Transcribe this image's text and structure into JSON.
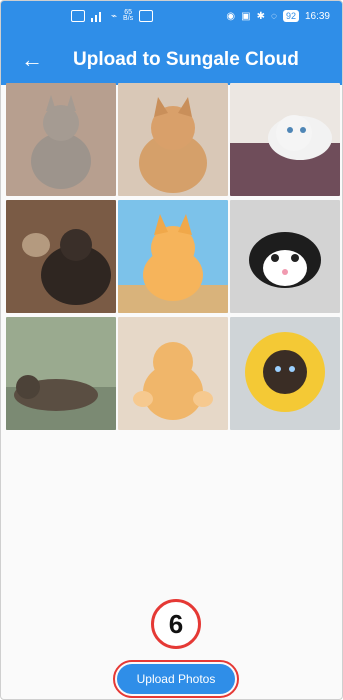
{
  "status_bar": {
    "time": "16:39",
    "battery": "92",
    "speed_top": "65",
    "speed_bottom": "B/s"
  },
  "app_bar": {
    "title": "Upload to Sungale Cloud",
    "back_icon": "back-arrow-icon"
  },
  "photos": [
    {
      "color_bg": "#b79f8f",
      "cat": "#9d948c"
    },
    {
      "color_bg": "#d9c8b7",
      "cat": "#d5a06a"
    },
    {
      "color_bg": "#ece7e2",
      "cat": "#f2f2f2"
    },
    {
      "color_bg": "#7a5b45",
      "cat": "#2f2621"
    },
    {
      "color_bg": "#7cc2ea",
      "cat": "#f6b45b"
    },
    {
      "color_bg": "#d3d3d3",
      "cat": "#ffffff"
    },
    {
      "color_bg": "#9aaa8f",
      "cat": "#5a4e42"
    },
    {
      "color_bg": "#e6d8c8",
      "cat": "#f0b66a"
    },
    {
      "color_bg": "#cfd4d7",
      "cat": "#3a2d25"
    }
  ],
  "annotation_step": "6",
  "upload_button": "Upload Photos"
}
